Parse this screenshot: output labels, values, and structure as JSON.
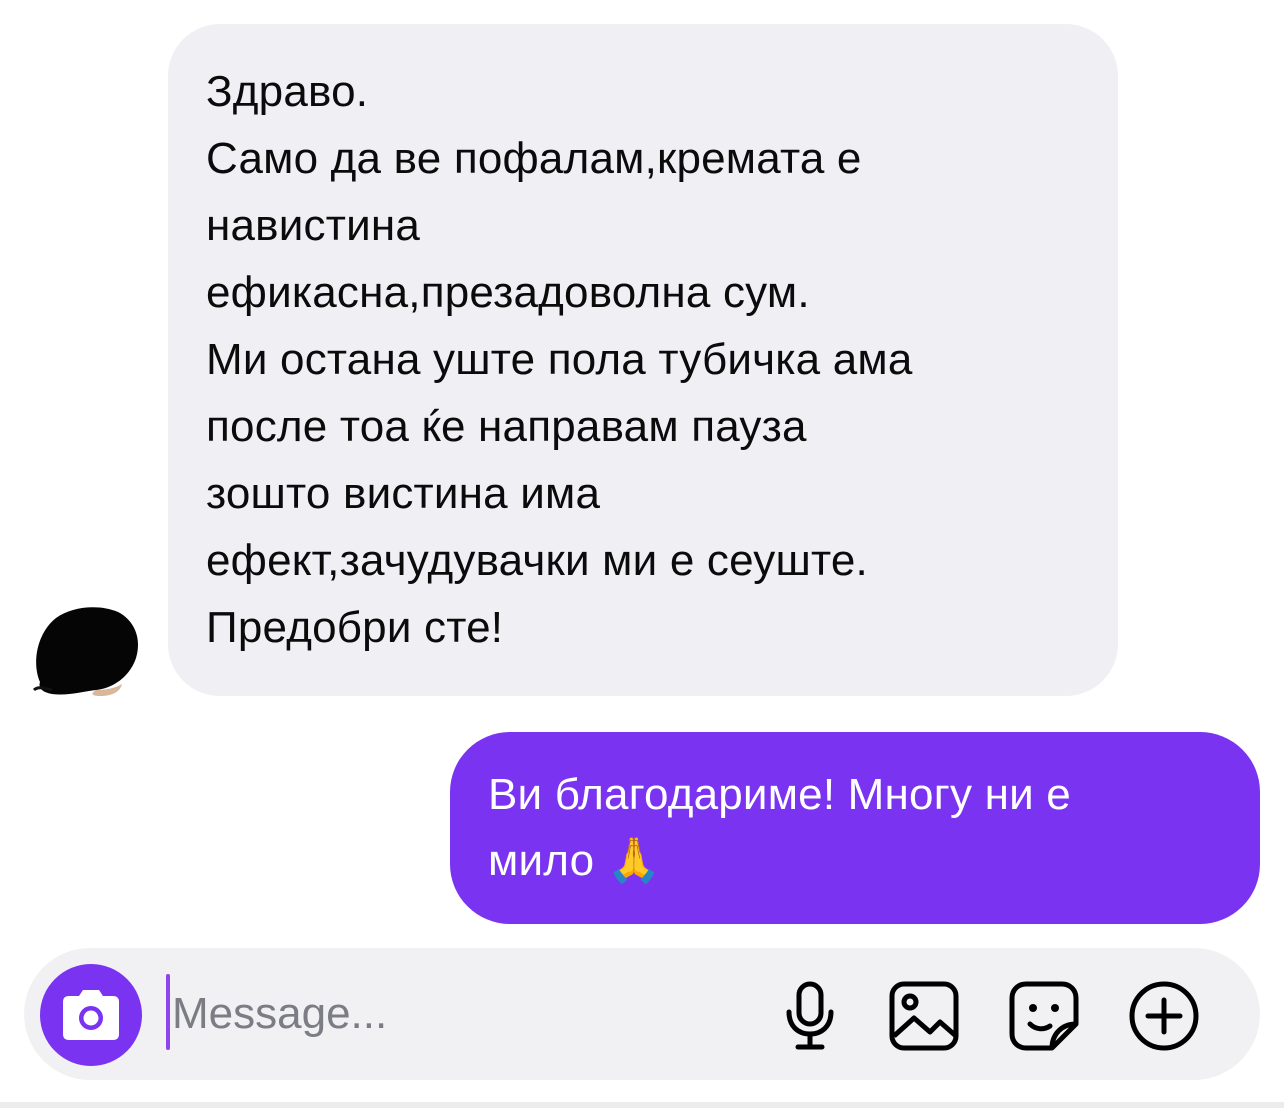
{
  "conversation": {
    "incoming": {
      "lines": [
        "Здраво.",
        "Само да ве пофалам,кремата е",
        "навистина",
        "ефикасна,презадоволна сум.",
        "Ми остана уште пола тубичка ама",
        "после тоа ќе направам пауза",
        "зошто вистина има",
        "ефект,зачудувачки ми е сеуште.",
        "Предобри сте!"
      ]
    },
    "outgoing": {
      "lines": [
        "Ви благодариме! Многу ни е",
        "мило 🙏"
      ]
    }
  },
  "composer": {
    "placeholder": "Message...",
    "value": "",
    "icons": [
      "camera-icon",
      "microphone-icon",
      "image-icon",
      "sticker-icon",
      "plus-icon"
    ]
  },
  "colors": {
    "accent": "#7b33f2",
    "incoming_bubble": "#efeff4",
    "composer_bg": "#f1f1f3"
  }
}
